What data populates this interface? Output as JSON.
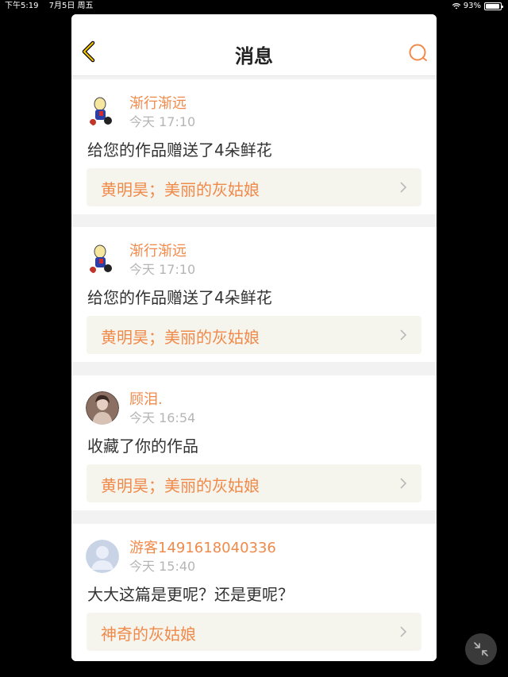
{
  "status_bar": {
    "time": "下午5:19",
    "date": "7月5日 周五",
    "battery": "93%",
    "battery_level": 0.93
  },
  "nav": {
    "title": "消息",
    "back_icon": "chevron-left-icon",
    "search_icon": "search-icon"
  },
  "messages": [
    {
      "user": "渐行渐远",
      "time": "今天 17:10",
      "text": "给您的作品赠送了4朵鲜花",
      "link": "黄明昊；美丽的灰姑娘",
      "avatar": "cartoon-avatar"
    },
    {
      "user": "渐行渐远",
      "time": "今天 17:10",
      "text": "给您的作品赠送了4朵鲜花",
      "link": "黄明昊；美丽的灰姑娘",
      "avatar": "cartoon-avatar"
    },
    {
      "user": "顾泪.",
      "time": "今天 16:54",
      "text": "收藏了你的作品",
      "link": "黄明昊；美丽的灰姑娘",
      "avatar": "photo-avatar"
    },
    {
      "user": "游客1491618040336",
      "time": "今天 15:40",
      "text": "大大这篇是更呢？还是更呢？",
      "link": "神奇的灰姑娘",
      "avatar": "default-avatar"
    }
  ],
  "colors": {
    "accent": "#f08a4b",
    "text": "#333333",
    "muted": "#b5b5b5",
    "link_bg": "#f5f5ee"
  }
}
